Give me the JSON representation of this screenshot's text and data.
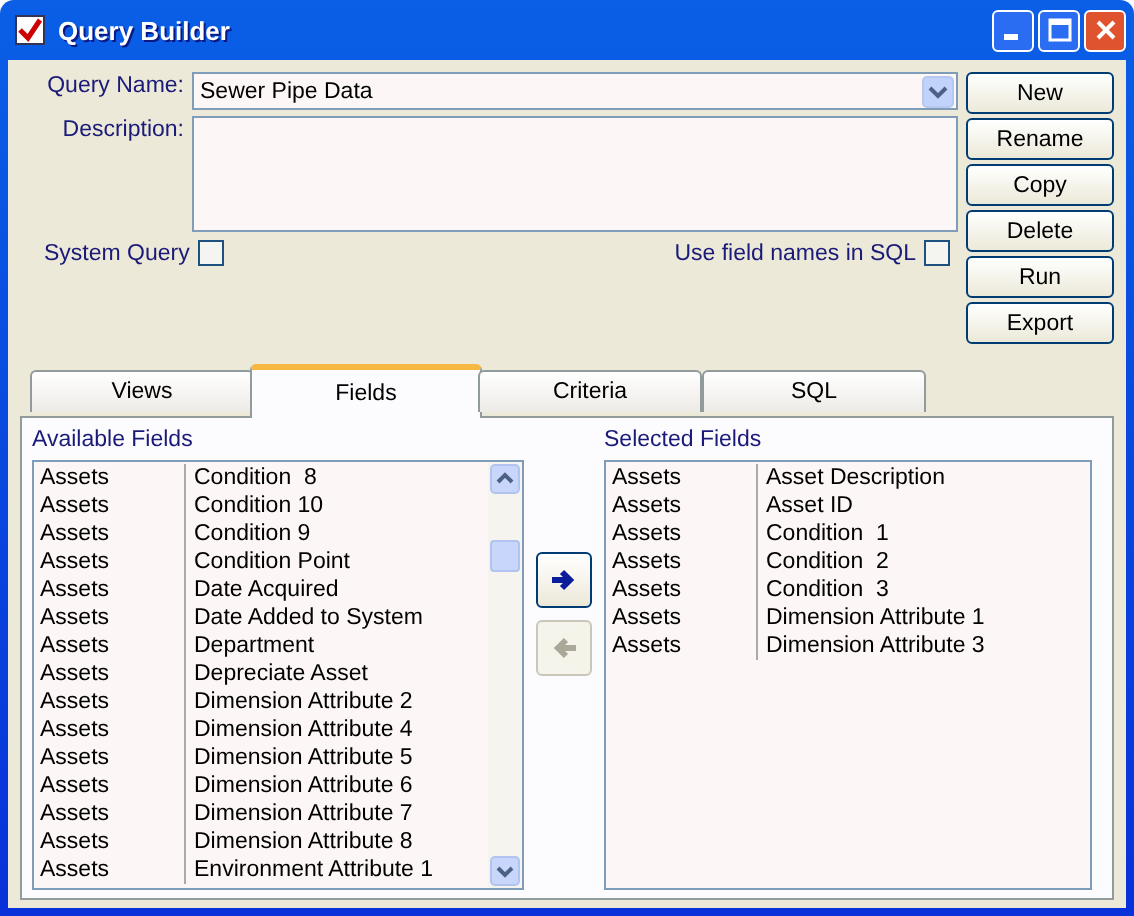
{
  "window": {
    "title": "Query Builder"
  },
  "form": {
    "query_name_label": "Query Name:",
    "query_name": "Sewer Pipe Data",
    "description_label": "Description:",
    "checkboxes": [
      {
        "label": "System Query",
        "checked": false
      },
      {
        "label": "Use field names in SQL",
        "checked": false
      }
    ]
  },
  "buttons": [
    "New",
    "Rename",
    "Copy",
    "Delete",
    "Run",
    "Export"
  ],
  "tabs": [
    {
      "label": "Views",
      "selected": false
    },
    {
      "label": "Fields",
      "selected": true
    },
    {
      "label": "Criteria",
      "selected": false
    },
    {
      "label": "SQL",
      "selected": false
    }
  ],
  "available_fields": {
    "title": "Available Fields",
    "rows": [
      [
        "Assets",
        "Condition  8"
      ],
      [
        "Assets",
        "Condition 10"
      ],
      [
        "Assets",
        "Condition 9"
      ],
      [
        "Assets",
        "Condition Point"
      ],
      [
        "Assets",
        "Date Acquired"
      ],
      [
        "Assets",
        "Date Added to System"
      ],
      [
        "Assets",
        "Department"
      ],
      [
        "Assets",
        "Depreciate Asset"
      ],
      [
        "Assets",
        "Dimension Attribute 2"
      ],
      [
        "Assets",
        "Dimension Attribute 4"
      ],
      [
        "Assets",
        "Dimension Attribute 5"
      ],
      [
        "Assets",
        "Dimension Attribute 6"
      ],
      [
        "Assets",
        "Dimension Attribute 7"
      ],
      [
        "Assets",
        "Dimension Attribute 8"
      ],
      [
        "Assets",
        "Environment Attribute 1"
      ]
    ]
  },
  "move_buttons": [
    {
      "kind": "add",
      "disabled": false
    },
    {
      "kind": "remove",
      "disabled": true
    }
  ],
  "selected_fields": {
    "title": "Selected Fields",
    "rows": [
      [
        "Assets",
        "Asset Description"
      ],
      [
        "Assets",
        "Asset ID"
      ],
      [
        "Assets",
        "Condition  1"
      ],
      [
        "Assets",
        "Condition  2"
      ],
      [
        "Assets",
        "Condition  3"
      ],
      [
        "Assets",
        "Dimension Attribute 1"
      ],
      [
        "Assets",
        "Dimension Attribute 3"
      ]
    ]
  }
}
